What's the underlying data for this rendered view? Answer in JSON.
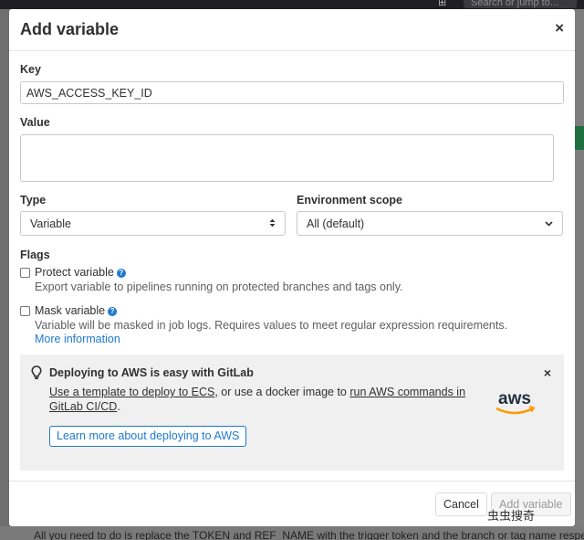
{
  "background": {
    "search_placeholder": "Search or jump to...",
    "bottom_text": "All you need to do is replace the TOKEN and REF_NAME with the trigger token and the branch or tag name respectively."
  },
  "modal": {
    "title": "Add variable",
    "close_icon": "×"
  },
  "key": {
    "label": "Key",
    "value": "AWS_ACCESS_KEY_ID"
  },
  "value_field": {
    "label": "Value",
    "value": ""
  },
  "type": {
    "label": "Type",
    "selected": "Variable",
    "icon": "updown-arrows-icon"
  },
  "environment_scope": {
    "label": "Environment scope",
    "selected": "All (default)",
    "icon": "chevron-down-icon"
  },
  "flags": {
    "label": "Flags",
    "protect": {
      "title": "Protect variable",
      "checked": false,
      "description": "Export variable to pipelines running on protected branches and tags only."
    },
    "mask": {
      "title": "Mask variable",
      "checked": false,
      "description": "Variable will be masked in job logs. Requires values to meet regular expression requirements.",
      "more_link": "More information"
    }
  },
  "alert": {
    "title": "Deploying to AWS is easy with GitLab",
    "body_link1": "Use a template to deploy to ECS",
    "body_mid": ", or use a docker image to ",
    "body_link2": "run AWS commands in GitLab CI/CD",
    "body_end": ".",
    "button": "Learn more about deploying to AWS",
    "logo_text": "aws",
    "close_icon": "×"
  },
  "footer": {
    "cancel": "Cancel",
    "add": "Add variable"
  },
  "watermark": "虫虫搜奇"
}
